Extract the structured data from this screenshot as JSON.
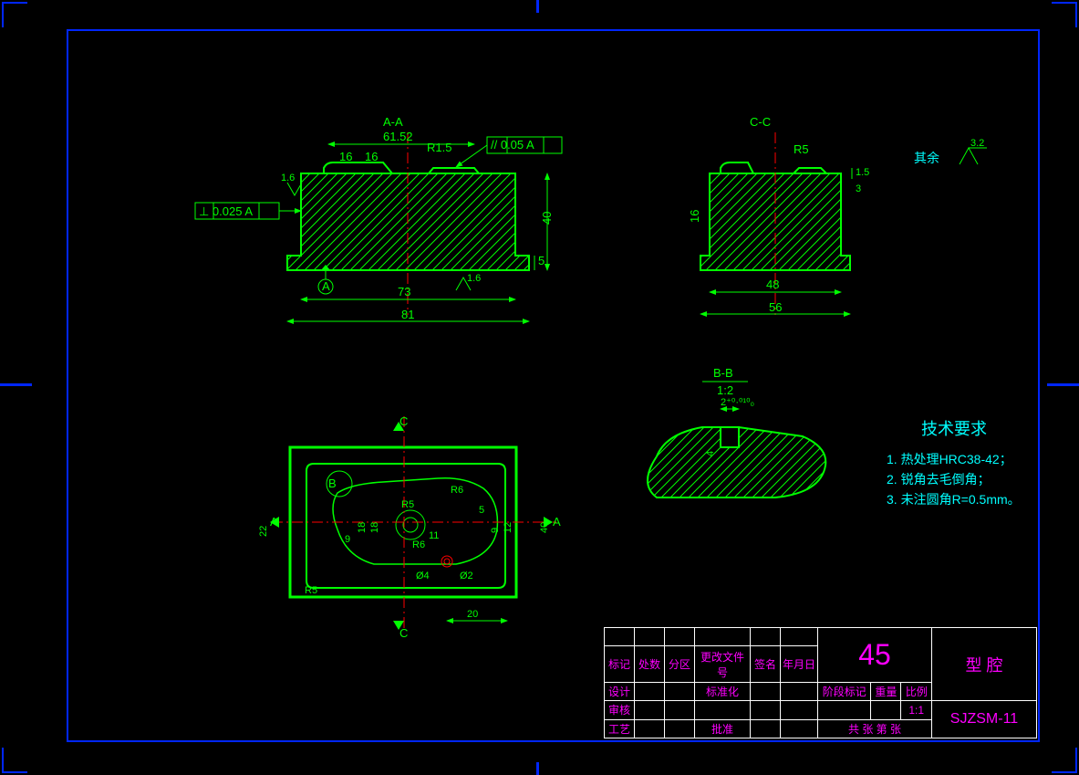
{
  "sections": {
    "aa_title": "A-A",
    "cc_title": "C-C",
    "bb_title": "B-B",
    "bb_scale": "1:2"
  },
  "dims_aa": {
    "d6152": "61.52",
    "d16a": "16",
    "d16b": "16",
    "r15": "R1.5",
    "gd": "// 0.05 A",
    "perp": "⊥ 0.025 A",
    "d16v": "1.6",
    "d40": "40",
    "d5": "5",
    "d73": "73",
    "d81": "81",
    "sf16": "1.6",
    "datumA": "A"
  },
  "dims_cc": {
    "r5": "R5",
    "d3": "3",
    "d15": "1.5",
    "d16": "16",
    "d48": "48",
    "d56": "56"
  },
  "dims_bb": {
    "tol": "2⁺⁰·⁰¹⁰₀",
    "d4": "4"
  },
  "dims_plan": {
    "C1": "C",
    "C2": "C",
    "A": "A",
    "B": "B",
    "d22": "22",
    "d9": "9",
    "d18a": "18",
    "d18b": "18",
    "r5a": "R5",
    "r5b": "R5",
    "r6a": "R6",
    "r6b": "R6",
    "d11": "11",
    "d5": "5",
    "phi4": "Ø4",
    "phi2": "Ø2",
    "d20": "20",
    "d9b": "9",
    "d12": "12",
    "d40": "40"
  },
  "notes": {
    "other": "其余",
    "sf": "3.2",
    "title": "技术要求",
    "l1": "1. 热处理HRC38-42；",
    "l2": "2. 锐角去毛倒角；",
    "l3": "3. 未注圆角R=0.5mm。"
  },
  "titleblock": {
    "num": "45",
    "part": "型 腔",
    "code": "SJZSM-11",
    "scale": "1:1",
    "r1c": [
      "标记",
      "处数",
      "分区",
      "更改文件号",
      "签名",
      "年月日"
    ],
    "r2": [
      "设计",
      "",
      "",
      "标准化",
      "",
      ""
    ],
    "r3": [
      "审核",
      "",
      "",
      "",
      "",
      ""
    ],
    "r4": [
      "工艺",
      "",
      "",
      "批准",
      "",
      ""
    ],
    "stage": "阶段标记",
    "weight": "重量",
    "scalelbl": "比例",
    "sheet": "共   张 第   张"
  }
}
